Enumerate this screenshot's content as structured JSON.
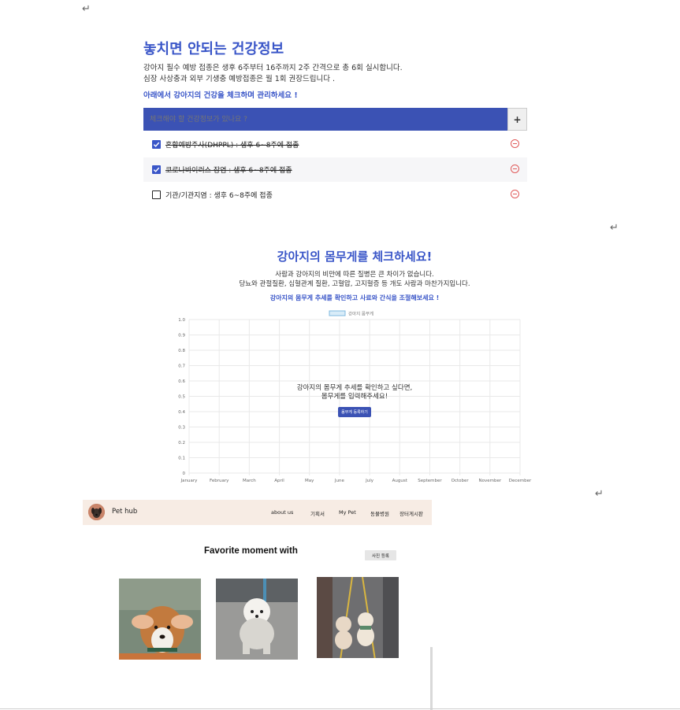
{
  "health": {
    "title": "놓치면 안되는 건강정보",
    "desc1": "강아지 필수 예방 접종은 생후 6주부터 16주까지 2주 간격으로 총 6회 실시합니다.",
    "desc2": "심장 사상충과 외부 기생충 예방접종은 월 1회 권장드립니다 .",
    "cta": "아래에서 강아지의 건강을 체크하며 관리하세요 !",
    "input_placeholder": "체크해야 할 건강정보가 있나요 ?",
    "add_label": "+",
    "todos": [
      {
        "text": "혼합예방주사(DHPPL) : 생후 6~8주에 접종",
        "checked": true
      },
      {
        "text": "코로나바이러스 장염 : 생후 6~8주에 접종",
        "checked": true
      },
      {
        "text": "기관/기관지염 : 생후 6~8주에 접종",
        "checked": false
      }
    ]
  },
  "weight": {
    "title": "강아지의 몸무게를 체크하세요!",
    "desc1": "사람과 강아지의 비만에 따른 질병은 큰 차이가 없습니다.",
    "desc2": "당뇨와 관절질환, 심혈관계 질환, 고혈압, 고지혈증 등 개도 사람과 마찬가지입니다.",
    "cta": "강아지의 몸무게 추세를 확인하고 사료와 간식을 조절해보세요 !",
    "overlay_line1": "강아지의 몸무게 추세를 확인하고 싶다면,",
    "overlay_line2": "몸무게를 입력해주세요!",
    "register_button": "몸무게 등록하기"
  },
  "chart_data": {
    "type": "line",
    "legend": "강아지 몸무게",
    "categories": [
      "January",
      "February",
      "March",
      "April",
      "May",
      "June",
      "July",
      "August",
      "September",
      "October",
      "November",
      "December"
    ],
    "series": [
      {
        "name": "강아지 몸무게",
        "values": []
      }
    ],
    "yticks": [
      "0",
      "0.1",
      "0.2",
      "0.3",
      "0.4",
      "0.5",
      "0.6",
      "0.7",
      "0.8",
      "0.9",
      "1.0"
    ],
    "ylim": [
      0,
      1.0
    ],
    "grid": true
  },
  "pethub": {
    "brand": "Pet hub",
    "nav": [
      "about us",
      "기획서",
      "My Pet",
      "동물병원",
      "장터게시판"
    ],
    "favorite_title": "Favorite moment with",
    "photo_button": "사진 등록"
  },
  "colors": {
    "accent": "#3a56c8",
    "input_bg": "#3b52b4",
    "delete": "#e05a5a",
    "header_bg": "#f7ece4"
  },
  "icons": {
    "return_mark": "↵",
    "check": "check-icon",
    "delete": "minus-circle-icon"
  }
}
